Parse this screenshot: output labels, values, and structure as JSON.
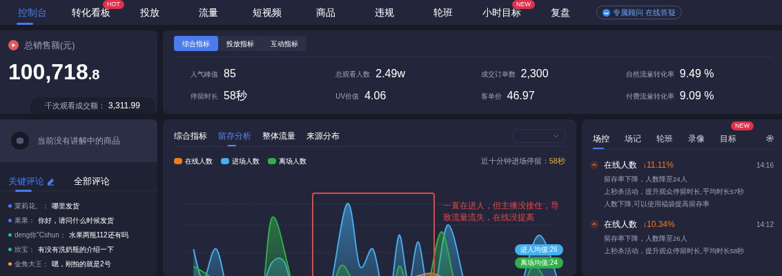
{
  "nav": {
    "items": [
      {
        "label": "控制台",
        "selected": true
      },
      {
        "label": "转化看板",
        "selected": false,
        "badge": "HOT"
      },
      {
        "label": "投放",
        "selected": false
      },
      {
        "label": "流量",
        "selected": false
      },
      {
        "label": "短视频",
        "selected": false
      },
      {
        "label": "商品",
        "selected": false
      },
      {
        "label": "违规",
        "selected": false
      },
      {
        "label": "轮班",
        "selected": false
      },
      {
        "label": "小时目标",
        "selected": false,
        "badge": "NEW"
      },
      {
        "label": "复盘",
        "selected": false
      }
    ],
    "help_button": "专属顾问 在线答疑"
  },
  "sales": {
    "label": "总销售额(元)",
    "value": "100,718",
    "decimal": ".8",
    "per_thousand_label": "千次观看成交额：",
    "per_thousand_value": "3,311.99"
  },
  "metrics": {
    "tabs": [
      {
        "label": "综合指标",
        "selected": true
      },
      {
        "label": "投放指标",
        "selected": false
      },
      {
        "label": "互动指标",
        "selected": false
      }
    ],
    "items": [
      {
        "label": "人气峰值",
        "value": "85"
      },
      {
        "label": "总观看人数",
        "value": "2.49w"
      },
      {
        "label": "成交订单数",
        "value": "2,300"
      },
      {
        "label": "自然流量转化率",
        "value": "9.49 %"
      },
      {
        "label": "停留时长",
        "value": "58秒"
      },
      {
        "label": "UV价值",
        "value": "4.06"
      },
      {
        "label": "客单价",
        "value": "46.97"
      },
      {
        "label": "付费流量转化率",
        "value": "9.09 %"
      }
    ]
  },
  "product": {
    "empty_text": "当前没有讲解中的商品"
  },
  "comments": {
    "tabs": [
      {
        "label": "关键评论",
        "selected": true
      },
      {
        "label": "全部评论",
        "selected": false
      }
    ],
    "items": [
      {
        "user": "茉莉花。：",
        "text": "哪里发货",
        "color": "#4a7cf0"
      },
      {
        "user": "果果：",
        "text": "你好，请问什么时候发货",
        "color": "#4a7cf0"
      },
      {
        "user": "deng你\"Cshun：",
        "text": "水果两瓶112还有吗",
        "color": "#2fb59a"
      },
      {
        "user": "欣宝：",
        "text": "有没有洗奶瓶的介绍一下",
        "color": "#2fb59a"
      },
      {
        "user": "金角大王：",
        "text": "嗯，刚拍的就是2号",
        "color": "#f0a030"
      }
    ]
  },
  "analysis": {
    "tabs": [
      {
        "label": "综合指标",
        "selected": false
      },
      {
        "label": "留存分析",
        "selected": true
      },
      {
        "label": "整体流量",
        "selected": false
      },
      {
        "label": "来源分布",
        "selected": false
      }
    ],
    "legend": [
      {
        "label": "在线人数",
        "color": "#f07a1c"
      },
      {
        "label": "进场人数",
        "color": "#43b0f0"
      },
      {
        "label": "离场人数",
        "color": "#2fb048"
      }
    ],
    "stay_label": "近十分钟进场停留：",
    "stay_value": "58秒",
    "annotation": "一直在进人，但主播没接住，导致流量流失，在线没提高",
    "averages": [
      {
        "label": "进人均值:26",
        "color": "#43b0f0"
      },
      {
        "label": "离场均值:24",
        "color": "#2fb048"
      }
    ]
  },
  "live_log": {
    "tabs": [
      {
        "label": "场控",
        "selected": true
      },
      {
        "label": "场记",
        "selected": false
      },
      {
        "label": "轮班",
        "selected": false
      },
      {
        "label": "录像",
        "selected": false
      },
      {
        "label": "目标",
        "selected": false,
        "badge": "NEW"
      }
    ],
    "entries": [
      {
        "title": "在线人数",
        "change": "↓11.11%",
        "time": "14:16",
        "notes": [
          "留存率下降，人数降至24人",
          "上秒杀活动，提升观众停留时长,平均时长57秒",
          "人数下降,可以使用福袋提高留存率"
        ]
      },
      {
        "title": "在线人数",
        "change": "↓10.34%",
        "time": "14:12",
        "notes": [
          "留存率下降，人数降至26人",
          "上秒杀活动，提升观众停留时长,平均时长58秒"
        ]
      }
    ]
  }
}
